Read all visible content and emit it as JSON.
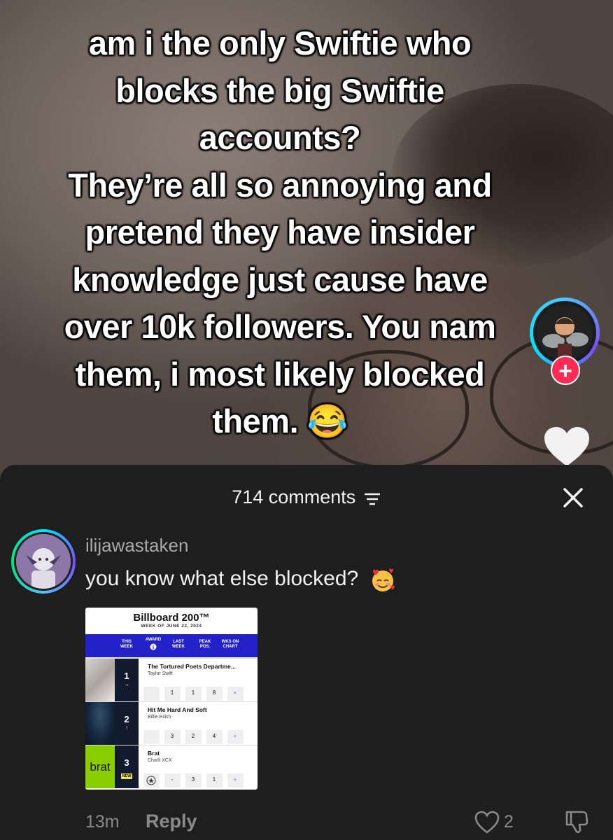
{
  "video": {
    "caption_lines": [
      "am i the only Swiftie who",
      "blocks the big Swiftie",
      "accounts?",
      "They’re all so annoying and",
      "pretend they have insider",
      "knowledge just cause have",
      "over 10k followers. You nam",
      "them, i most likely blocked",
      "them. 😂"
    ],
    "follow_label": "+"
  },
  "comments_panel": {
    "count_label": "714 comments",
    "close_icon": "close-icon",
    "sort_icon": "sort-icon"
  },
  "comment": {
    "username": "ilijawastaken",
    "text": "you know what else blocked?",
    "time": "13m",
    "reply_label": "Reply",
    "like_count": "2",
    "image": {
      "title": "Billboard 200™",
      "subtitle": "WEEK OF JUNE 22, 2024",
      "columns": [
        "THIS WEEK",
        "AWARD",
        "LAST WEEK",
        "PEAK POS.",
        "WKS ON CHART"
      ],
      "rows": [
        {
          "rank": "1",
          "movement": "→",
          "title": "The Tortured Poets Departme...",
          "artist": "Taylor Swift",
          "last_week": "1",
          "peak": "1",
          "weeks": "8"
        },
        {
          "rank": "2",
          "movement": "↑",
          "title": "Hit Me Hard And Soft",
          "artist": "Billie Eilish",
          "last_week": "3",
          "peak": "2",
          "weeks": "4"
        },
        {
          "rank": "3",
          "movement": "NEW",
          "title": "Brat",
          "artist": "Charli XCX",
          "last_week": "-",
          "peak": "3",
          "weeks": "1"
        }
      ],
      "brat_cover_text": "brat",
      "award_icon": "info-icon",
      "plus": "+"
    }
  }
}
